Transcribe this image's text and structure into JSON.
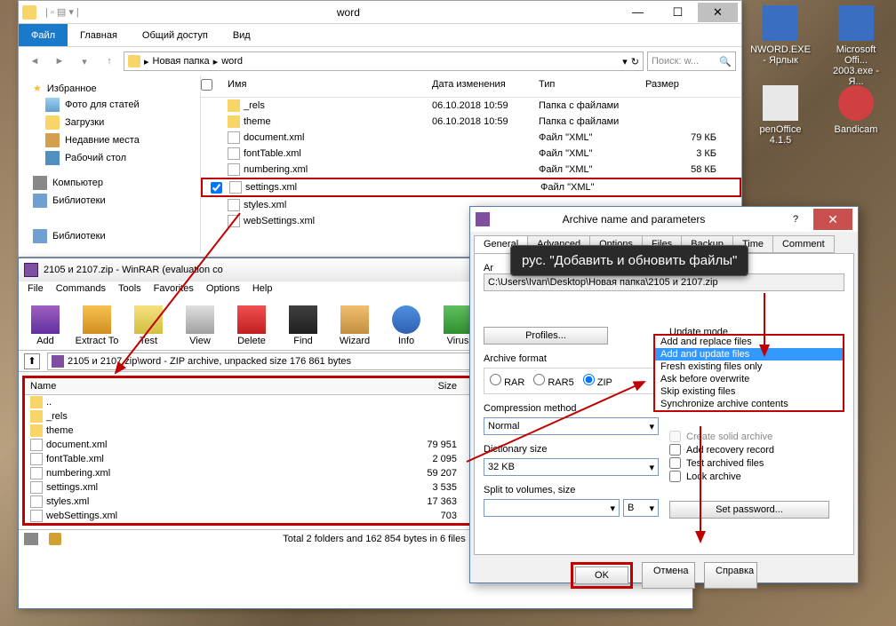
{
  "desktop": {
    "icons": [
      {
        "label": "NWORD.EXE - Ярлык"
      },
      {
        "label": "Microsoft Offi... 2003.exe - Я..."
      },
      {
        "label": "penOffice 4.1.5"
      },
      {
        "label": "Bandicam"
      }
    ]
  },
  "explorer": {
    "title": "word",
    "ribbon": {
      "file": "Файл",
      "tabs": [
        "Главная",
        "Общий доступ",
        "Вид"
      ]
    },
    "breadcrumb": [
      "Новая папка",
      "word"
    ],
    "search_placeholder": "Поиск: w...",
    "sidebar": {
      "fav_header": "Избранное",
      "fav_items": [
        "Фото для статей",
        "Загрузки",
        "Недавние места",
        "Рабочий стол"
      ],
      "computer": "Компьютер",
      "libraries": "Библиотеки",
      "libraries2": "Библиотеки"
    },
    "columns": {
      "name": "Имя",
      "date": "Дата изменения",
      "type": "Тип",
      "size": "Размер"
    },
    "rows": [
      {
        "name": "_rels",
        "date": "06.10.2018 10:59",
        "type": "Папка с файлами",
        "size": ""
      },
      {
        "name": "theme",
        "date": "06.10.2018 10:59",
        "type": "Папка с файлами",
        "size": ""
      },
      {
        "name": "document.xml",
        "date": "",
        "type": "Файл \"XML\"",
        "size": "79 КБ"
      },
      {
        "name": "fontTable.xml",
        "date": "",
        "type": "Файл \"XML\"",
        "size": "3 КБ"
      },
      {
        "name": "numbering.xml",
        "date": "",
        "type": "Файл \"XML\"",
        "size": "58 КБ"
      },
      {
        "name": "settings.xml",
        "date": "",
        "type": "Файл \"XML\"",
        "size": "",
        "highlighted": true,
        "checked": true
      },
      {
        "name": "styles.xml",
        "date": "",
        "type": "",
        "size": ""
      },
      {
        "name": "webSettings.xml",
        "date": "",
        "type": "",
        "size": ""
      }
    ]
  },
  "winrar": {
    "title": "2105 и 2107.zip - WinRAR (evaluation co",
    "menu": [
      "File",
      "Commands",
      "Tools",
      "Favorites",
      "Options",
      "Help"
    ],
    "tools": [
      "Add",
      "Extract To",
      "Test",
      "View",
      "Delete",
      "Find",
      "Wizard",
      "Info",
      "Virus"
    ],
    "path": "2105 и 2107.zip\\word - ZIP archive, unpacked size 176 861 bytes",
    "columns": {
      "name": "Name",
      "size": "Size"
    },
    "rows": [
      {
        "name": "..",
        "size": ""
      },
      {
        "name": "_rels",
        "size": ""
      },
      {
        "name": "theme",
        "size": ""
      },
      {
        "name": "document.xml",
        "size": "79 951"
      },
      {
        "name": "fontTable.xml",
        "size": "2 095"
      },
      {
        "name": "numbering.xml",
        "size": "59 207"
      },
      {
        "name": "settings.xml",
        "size": "3 535"
      },
      {
        "name": "styles.xml",
        "size": "17 363"
      },
      {
        "name": "webSettings.xml",
        "size": "703"
      }
    ],
    "status": "Total 2 folders and 162 854 bytes in 6 files"
  },
  "dialog": {
    "title": "Archive name and parameters",
    "tabs": [
      "General",
      "Advanced",
      "Options",
      "Files",
      "Backup",
      "Time",
      "Comment"
    ],
    "tooltip": "рус. \"Добавить и обновить файлы\"",
    "archive_label": "Ar",
    "archive_value": "C:\\Users\\Ivan\\Desktop\\Новая папка\\2105 и 2107.zip",
    "profiles_btn": "Profiles...",
    "archive_format_label": "Archive format",
    "formats": [
      "RAR",
      "RAR5",
      "ZIP"
    ],
    "compression_label": "Compression method",
    "compression_value": "Normal",
    "dictionary_label": "Dictionary size",
    "dictionary_value": "32 KB",
    "split_label": "Split to volumes, size",
    "split_unit": "B",
    "update_label": "Update mode",
    "update_value": "Add and replace files",
    "update_options": [
      "Add and replace files",
      "Add and update files",
      "Fresh existing files only",
      "Ask before overwrite",
      "Skip existing files",
      "Synchronize archive contents"
    ],
    "arch_options": [
      {
        "text": "Create solid archive",
        "disabled": true
      },
      {
        "text": "Add recovery record",
        "disabled": false
      },
      {
        "text": "Test archived files",
        "disabled": false
      },
      {
        "text": "Lock archive",
        "disabled": false
      }
    ],
    "set_password_btn": "Set password...",
    "ok": "OK",
    "cancel": "Отмена",
    "help": "Справка"
  }
}
